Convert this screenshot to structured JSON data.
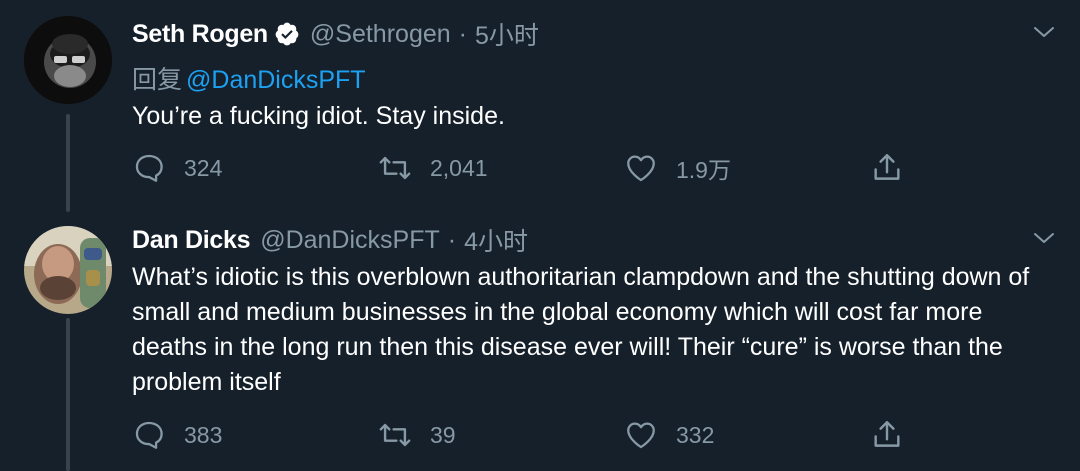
{
  "tweets": [
    {
      "display_name": "Seth Rogen",
      "verified": true,
      "handle": "@Sethrogen",
      "separator": "·",
      "time": "5小时",
      "reply_prefix": "回复",
      "reply_to": "@DanDicksPFT",
      "text": "You’re a fucking idiot. Stay inside.",
      "stats": {
        "replies": "324",
        "retweets": "2,041",
        "likes": "1.9万"
      }
    },
    {
      "display_name": "Dan Dicks",
      "verified": false,
      "handle": "@DanDicksPFT",
      "separator": "·",
      "time": "4小时",
      "text": "What’s idiotic is this overblown authoritarian clampdown and the shutting down of small and medium businesses in the global economy which will cost far more deaths in the long run then this disease ever will! Their “cure” is worse than the problem itself",
      "stats": {
        "replies": "383",
        "retweets": "39",
        "likes": "332"
      }
    }
  ],
  "icons": {
    "reply": "reply-icon",
    "retweet": "retweet-icon",
    "like": "heart-icon",
    "share": "share-icon",
    "menu": "chevron-down-icon",
    "verified": "verified-badge-icon"
  },
  "colors": {
    "background": "#15202b",
    "primary_text": "#ffffff",
    "secondary_text": "#8899a6",
    "link": "#1da1f2",
    "thread_line": "#38444d"
  }
}
